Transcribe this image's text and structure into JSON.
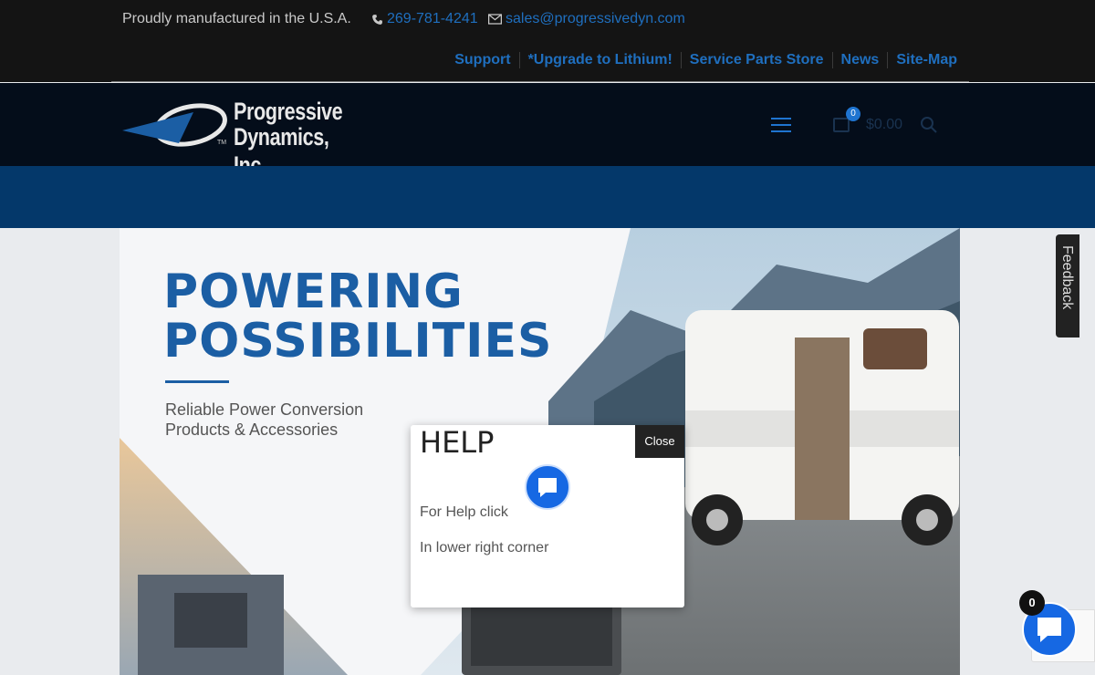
{
  "topbar": {
    "tagline": "Proudly manufactured in the U.S.A.",
    "phone": "269-781-4241",
    "email": "sales@progressivedyn.com",
    "menu": [
      "Support",
      "*Upgrade to Lithium!",
      "Service Parts Store",
      "News",
      "Site-Map"
    ]
  },
  "header": {
    "logo_line1": "Progressive",
    "logo_line2": "Dynamics, Inc.",
    "logo_tm": "TM",
    "cart_count": "0",
    "cart_amount": "$0.00"
  },
  "hero": {
    "title_line1": "POWERING",
    "title_line2": "POSSIBILITIES",
    "subtitle_line1": "Reliable Power Conversion",
    "subtitle_line2": "Products & Accessories"
  },
  "feedback": {
    "label": "Feedback"
  },
  "modal": {
    "heading": "HELP",
    "close_label": "Close",
    "line1": "For Help click",
    "line2": "In lower right corner"
  },
  "chat": {
    "unread_count": "0"
  },
  "colors": {
    "accent": "#1f6fbf",
    "header_bg": "#040d1a",
    "band_bg": "#04386a",
    "chat_blue": "#1668e3"
  },
  "icons": [
    "phone-icon",
    "mail-icon",
    "menu-icon",
    "cart-icon",
    "search-icon",
    "chat-icon"
  ]
}
